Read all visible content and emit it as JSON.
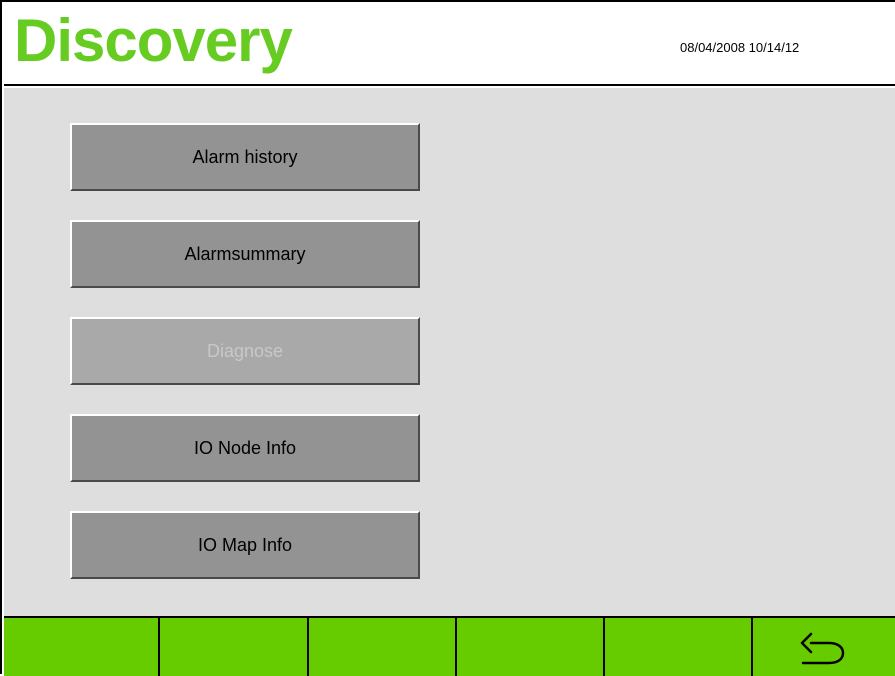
{
  "header": {
    "title": "Discovery",
    "datetime": "08/04/2008 10/14/12"
  },
  "menu": {
    "buttons": [
      {
        "label": "Alarm history",
        "enabled": true
      },
      {
        "label": "Alarmsummary",
        "enabled": true
      },
      {
        "label": "Diagnose",
        "enabled": false
      },
      {
        "label": "IO Node Info",
        "enabled": true
      },
      {
        "label": "IO Map Info",
        "enabled": true
      }
    ]
  },
  "footer": {
    "keys": [
      "",
      "",
      "",
      "",
      "",
      ""
    ],
    "back_icon": "back-arrow-icon"
  },
  "colors": {
    "title": "#66cc22",
    "footer": "#66cc00",
    "background": "#dedede",
    "button": "#939393",
    "button_disabled": "#a9a9a9"
  }
}
